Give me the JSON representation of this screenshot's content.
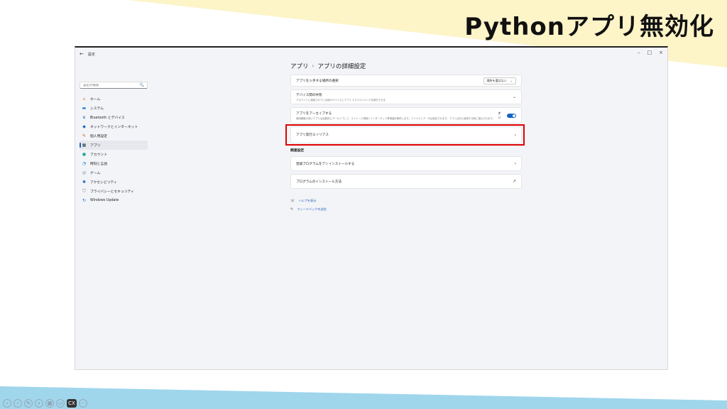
{
  "slide": {
    "title": "Pythonアプリ無効化",
    "colors": {
      "top_band": "#fdf4c8",
      "bottom_band": "#9fd6ec",
      "highlight": "#e00000",
      "accent": "#1565c0"
    }
  },
  "window": {
    "back_icon": "arrow-left-icon",
    "app_title": "設定",
    "controls": {
      "minimize": "–",
      "maximize": "□",
      "close": "×"
    }
  },
  "sidebar": {
    "search_placeholder": "設定の検索",
    "search_icon": "🔍",
    "items": [
      {
        "label": "ホーム",
        "icon": "home-icon",
        "glyph": "⌂",
        "color": "#e07b39"
      },
      {
        "label": "システム",
        "icon": "system-icon",
        "glyph": "▬",
        "color": "#1976d2"
      },
      {
        "label": "Bluetooth とデバイス",
        "icon": "bluetooth-icon",
        "glyph": "ʙ",
        "color": "#1565c0"
      },
      {
        "label": "ネットワークとインターネット",
        "icon": "network-icon",
        "glyph": "◆",
        "color": "#1565c0"
      },
      {
        "label": "個人用設定",
        "icon": "brush-icon",
        "glyph": "✎",
        "color": "#d35400"
      },
      {
        "label": "アプリ",
        "icon": "apps-icon",
        "glyph": "▦",
        "color": "#37474f",
        "active": true
      },
      {
        "label": "アカウント",
        "icon": "account-icon",
        "glyph": "●",
        "color": "#26a69a"
      },
      {
        "label": "時刻と言語",
        "icon": "time-icon",
        "glyph": "◔",
        "color": "#1e88e5"
      },
      {
        "label": "ゲーム",
        "icon": "game-icon",
        "glyph": "◎",
        "color": "#607d8b"
      },
      {
        "label": "アクセシビリティ",
        "icon": "accessibility-icon",
        "glyph": "✱",
        "color": "#1565c0"
      },
      {
        "label": "プライバシーとセキュリティ",
        "icon": "shield-icon",
        "glyph": "⛉",
        "color": "#607d8b"
      },
      {
        "label": "Windows Update",
        "icon": "update-icon",
        "glyph": "↻",
        "color": "#1565c0"
      }
    ]
  },
  "main": {
    "breadcrumb": {
      "parent": "アプリ",
      "separator": "›",
      "current": "アプリの詳細設定"
    },
    "cards": {
      "source": {
        "label": "アプリを入手する場所の選択",
        "value": "場所を選ばない",
        "chevron": "⌄"
      },
      "share": {
        "label": "デバイス間の共有",
        "desc": "アカウントに接続されている他のデバイスとアプリ エクスペリエンスを続行できる",
        "chevron": "⌄"
      },
      "archive": {
        "label": "アプリをアーカイブする",
        "desc": "使用頻度の低いアプリは自動的にアーカイブして、ストレージ領域とインターネット帯域幅を節約します。ファイルとデータは保存されます。アプリは次に使用する時に復元されます。",
        "toggle_label": "オン"
      },
      "alias": {
        "label": "アプリ実行エイリアス",
        "chevron": "›"
      }
    },
    "related_title": "関連設定",
    "related": [
      {
        "label": "登録プログラムをアンインストールする",
        "chevron": "›"
      },
      {
        "label": "プログラムのインストール方法",
        "chevron": "↗"
      }
    ],
    "links": [
      {
        "label": "ヘルプを表示",
        "icon": "help-icon"
      },
      {
        "label": "フィードバックの送信",
        "icon": "feedback-icon"
      }
    ]
  }
}
